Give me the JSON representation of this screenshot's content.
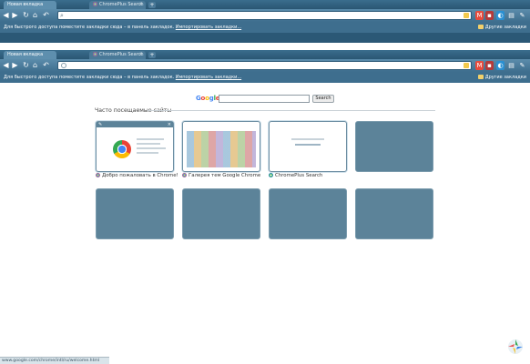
{
  "colors": {
    "frame": "#2b5876",
    "toolbar": "#4a7998",
    "tile": "#5c8399",
    "accent": "#4285f4"
  },
  "back_window": {
    "tabs": [
      {
        "label": "Новая вкладка",
        "active": true
      },
      {
        "label": "ChromePlus Search",
        "active": false
      }
    ],
    "bookmarks_hint_text": "Для быстрого доступа поместите закладки сюда – в панель закладок. ",
    "bookmarks_hint_link": "Импортировать закладки...",
    "other_bookmarks": "Другие закладки"
  },
  "front_window": {
    "tabs": [
      {
        "label": "Новая вкладка",
        "active": true
      },
      {
        "label": "ChromePlus Search",
        "active": false
      }
    ],
    "bookmarks_hint_text": "Для быстрого доступа поместите закладки сюда – в панель закладок. ",
    "bookmarks_hint_link": "Импортировать закладки...",
    "other_bookmarks": "Другие закладки",
    "search": {
      "logo": [
        "G",
        "o",
        "o",
        "g",
        "l",
        "e"
      ],
      "button_label": "Search",
      "value": ""
    },
    "most_visited_title": "Часто посещаемые сайты",
    "tiles": [
      {
        "label": "Добро пожаловать в Chrome!",
        "thumb": true
      },
      {
        "label": "Галерея тем Google Chrome",
        "thumb": true
      },
      {
        "label": "ChromePlus Search",
        "thumb": true
      },
      {
        "label": "",
        "thumb": false
      },
      {
        "label": "",
        "thumb": false
      },
      {
        "label": "",
        "thumb": false
      },
      {
        "label": "",
        "thumb": false
      },
      {
        "label": "",
        "thumb": false
      }
    ],
    "status_url": "www.google.com/chrome/intl/ru/welcome.html"
  }
}
